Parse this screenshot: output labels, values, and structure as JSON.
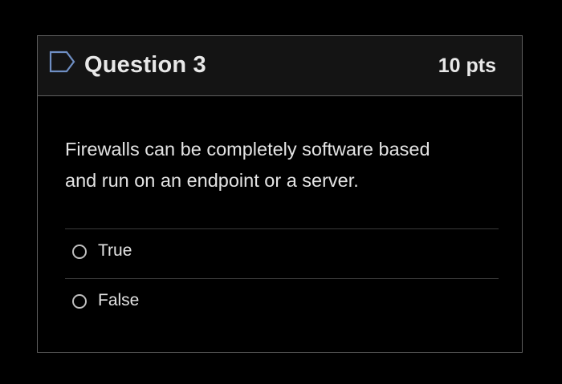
{
  "question": {
    "title": "Question 3",
    "points": "10 pts",
    "text_line1": "Firewalls can be completely software based",
    "text_line2": "and run on an endpoint or a server.",
    "flag_icon": "flag-outline-icon"
  },
  "answers": [
    {
      "label": "True",
      "selected": false
    },
    {
      "label": "False",
      "selected": false
    }
  ],
  "colors": {
    "background": "#000000",
    "header_background": "#141414",
    "border": "#5f5f5f",
    "text": "#e3e3e3"
  }
}
